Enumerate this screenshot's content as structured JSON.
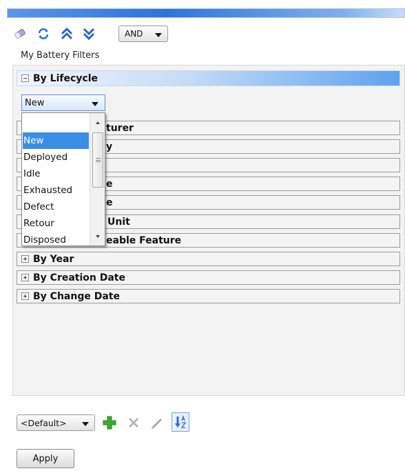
{
  "toolbar": {
    "icons": [
      "eraser-icon",
      "refresh-icon",
      "expand-all-icon",
      "collapse-all-icon"
    ],
    "operator_value": "AND"
  },
  "filters_label": "My Battery Filters",
  "sections": {
    "lifecycle": "By Lifecycle",
    "visible_rows": [
      {
        "name": "row-manufacturer",
        "label": "turer"
      },
      {
        "name": "row-2",
        "label": "y"
      },
      {
        "name": "row-3",
        "label": ""
      },
      {
        "name": "row-4",
        "label": "e"
      },
      {
        "name": "row-5",
        "label": "e"
      },
      {
        "name": "row-unit",
        "label": "Unit"
      },
      {
        "name": "row-feature",
        "label": "eable Feature"
      },
      {
        "name": "row-year",
        "label": "By Year"
      },
      {
        "name": "row-creation-date",
        "label": "By Creation Date"
      },
      {
        "name": "row-change-date",
        "label": "By Change Date"
      }
    ]
  },
  "lifecycle_combo": {
    "value": "New",
    "options": [
      "",
      "New",
      "Deployed",
      "Idle",
      "Exhausted",
      "Defect",
      "Retour",
      "Disposed"
    ],
    "selected_index": 1
  },
  "bottom": {
    "preset_value": "<Default>",
    "icons": [
      "add-icon",
      "delete-icon",
      "edit-icon",
      "sort-az-icon"
    ],
    "apply_label": "Apply"
  },
  "colors": {
    "accent": "#3a8ee6",
    "header_gradient_end": "#5ea2ee",
    "add_green": "#3cab2c"
  }
}
